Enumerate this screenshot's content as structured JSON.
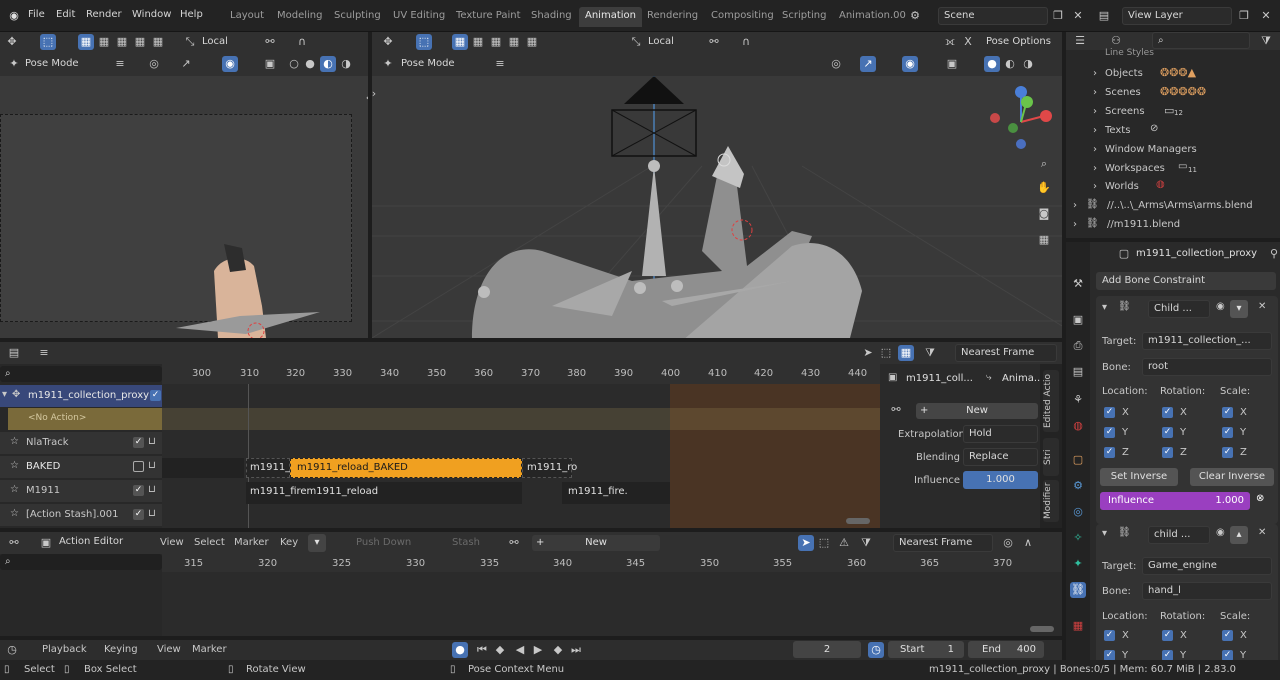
{
  "menu": [
    "File",
    "Edit",
    "Render",
    "Window",
    "Help"
  ],
  "workspaces": [
    "Layout",
    "Modeling",
    "Sculpting",
    "UV Editing",
    "Texture Paint",
    "Shading",
    "Animation",
    "Rendering",
    "Compositing",
    "Scripting",
    "Animation.00"
  ],
  "active_workspace": "Animation",
  "scene": "Scene",
  "view_layer": "View Layer",
  "left_view": {
    "transform": "Local",
    "mode": "Pose Mode"
  },
  "main_view": {
    "transform": "Local",
    "mode": "Pose Mode",
    "pose_options": "Pose Options"
  },
  "outliner": {
    "items": [
      "Line Styles",
      "Objects",
      "Scenes",
      "Screens",
      "Texts",
      "Window Managers",
      "Workspaces",
      "Worlds"
    ],
    "screens_badge": "12",
    "workspaces_badge": "11",
    "libs": [
      "//..\\..\\_Arms\\Arms\\arms.blend",
      "//m1911.blend"
    ]
  },
  "properties": {
    "object": "m1911_collection_proxy",
    "add_constraint": "Add Bone Constraint",
    "c1": {
      "name": "Child ...",
      "target_label": "Target:",
      "target": "m1911_collection_...",
      "bone_label": "Bone:",
      "bone": "root",
      "loc": "Location:",
      "rot": "Rotation:",
      "scale": "Scale:",
      "axes": [
        "X",
        "Y",
        "Z"
      ],
      "set_inverse": "Set Inverse",
      "clear_inverse": "Clear Inverse",
      "influence_label": "Influence",
      "influence": "1.000"
    },
    "c2": {
      "name": "child ...",
      "target_label": "Target:",
      "target": "Game_engine",
      "bone_label": "Bone:",
      "bone": "hand_l",
      "loc": "Location:",
      "rot": "Rotation:",
      "scale": "Scale:",
      "axes": [
        "X",
        "Y"
      ]
    }
  },
  "nla": {
    "snap": "Nearest Frame",
    "frames": [
      "300",
      "310",
      "320",
      "330",
      "340",
      "350",
      "360",
      "370",
      "380",
      "390",
      "400",
      "410",
      "420",
      "430",
      "440"
    ],
    "tracks": [
      {
        "name": "m1911_collection_proxy"
      },
      {
        "name": "<No Action>"
      },
      {
        "name": "NlaTrack"
      },
      {
        "name": "BAKED"
      },
      {
        "name": "M1911"
      },
      {
        "name": "[Action Stash].001"
      }
    ],
    "strips": {
      "baked_a": "m1911_fi",
      "baked_b": "m1911_reload_BAKED",
      "baked_c": "m1911_ro",
      "m_a": "m1911_firem1911_reload",
      "m_b": "m1911_fire."
    },
    "side": {
      "object": "m1911_coll...",
      "anim": "Anima...",
      "new": "New",
      "extrapolation_label": "Extrapolation",
      "extrapolation": "Hold",
      "blending_label": "Blending",
      "blending": "Replace",
      "influence_label": "Influence",
      "influence": "1.000"
    },
    "vtabs": [
      "Edited Actio",
      "Stri",
      "Modifier"
    ]
  },
  "action_editor": {
    "mode": "Action Editor",
    "menu": [
      "View",
      "Select",
      "Marker",
      "Key"
    ],
    "push_down": "Push Down",
    "stash": "Stash",
    "new": "New",
    "snap": "Nearest Frame",
    "frames": [
      "315",
      "320",
      "325",
      "330",
      "335",
      "340",
      "345",
      "350",
      "355",
      "360",
      "365",
      "370"
    ]
  },
  "timeline": {
    "menu": [
      "Playback",
      "Keying",
      "View",
      "Marker"
    ],
    "current": "2",
    "start_label": "Start",
    "start": "1",
    "end_label": "End",
    "end": "400"
  },
  "status": {
    "select": "Select",
    "box_select": "Box Select",
    "rotate": "Rotate View",
    "context": "Pose Context Menu",
    "info": "m1911_collection_proxy | Bones:0/5 | Mem: 60.7 MiB | 2.83.0"
  }
}
